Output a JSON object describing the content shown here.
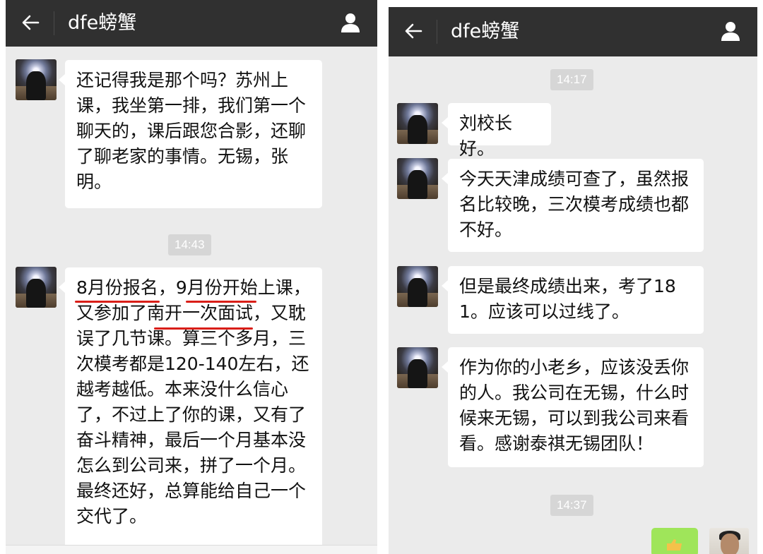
{
  "left": {
    "title": "dfe螃蟹",
    "messages": [
      "还记得我是那个吗？苏州上课，我坐第一排，我们第一个聊天的，课后跟您合影，还聊了聊老家的事情。无锡，张明。",
      "8月份报名，9月份开始上课，又参加了南开一次面试，又耽误了几节课。算三个多月，三次模考都是120-140左右，还越考越低。本来没什么信心了，不过上了你的课，又有了奋斗精神，最后一个月基本没怎么到公司来，拼了一个月。最终还好，总算能给自己一个交代了。"
    ],
    "timestamps": [
      "14:43"
    ]
  },
  "right": {
    "title": "dfe螃蟹",
    "messages": [
      "刘校长好。",
      "今天天津成绩可查了，虽然报名比较晚，三次模考成绩也都不好。",
      "但是最终成绩出来，考了181。应该可以过线了。",
      "作为你的小老乡，应该没丢你的人。我公司在无锡，什么时候来无锡，可以到我公司来看看。感谢泰祺无锡团队！"
    ],
    "timestamps": [
      "14:17",
      "14:37"
    ]
  },
  "icons": {
    "back": "back-arrow-icon",
    "profile": "person-icon"
  },
  "colors": {
    "header_bg": "#303030",
    "chat_bg": "#ebebeb",
    "bubble_bg": "#ffffff",
    "timestamp_bg": "#d6d6d6",
    "underline": "#d91e18",
    "self_bubble": "#9fe55a"
  }
}
